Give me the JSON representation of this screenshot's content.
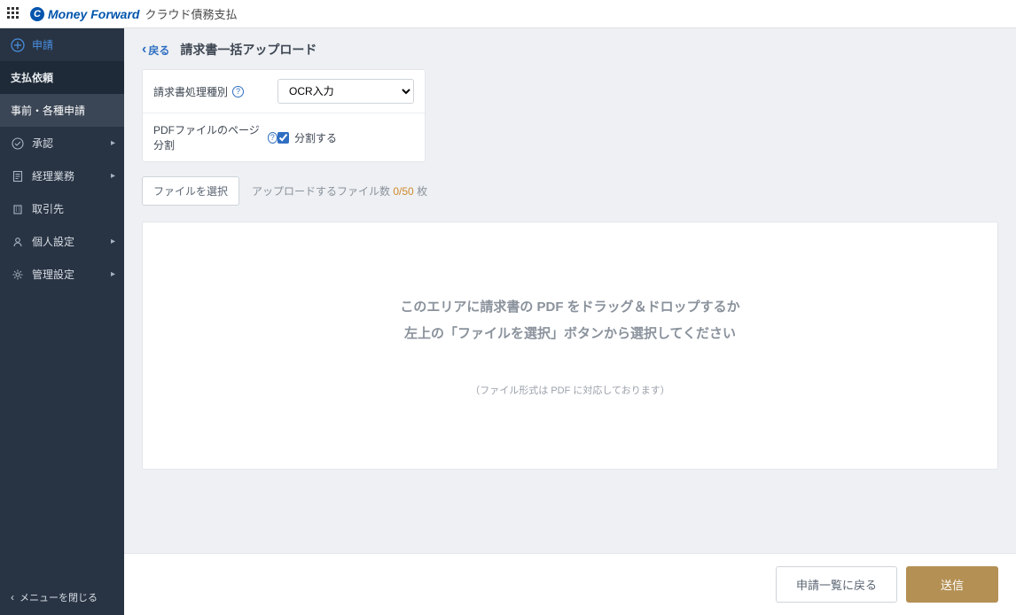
{
  "header": {
    "brand_mark": "C",
    "brand_text": "Money Forward",
    "product_name": "クラウド債務支払"
  },
  "sidebar": {
    "primary_action": "申請",
    "section_label": "支払依頼",
    "items": [
      {
        "label": "事前・各種申請",
        "expandable": false,
        "active": true
      },
      {
        "label": "承認",
        "expandable": true
      },
      {
        "label": "経理業務",
        "expandable": true
      },
      {
        "label": "取引先",
        "expandable": false
      },
      {
        "label": "個人設定",
        "expandable": true
      },
      {
        "label": "管理設定",
        "expandable": true
      }
    ],
    "collapse_label": "メニューを閉じる"
  },
  "page": {
    "back_label": "戻る",
    "title": "請求書一括アップロード"
  },
  "settings": {
    "type_label": "請求書処理種別",
    "type_value": "OCR入力",
    "split_label": "PDFファイルのページ分割",
    "split_checkbox_label": "分割する",
    "split_checked": true
  },
  "upload": {
    "select_button": "ファイルを選択",
    "count_prefix": "アップロードするファイル数 ",
    "count_current": "0",
    "count_max": "/50",
    "count_suffix": " 枚",
    "drop_line1": "このエリアに請求書の PDF をドラッグ＆ドロップするか",
    "drop_line2": "左上の「ファイルを選択」ボタンから選択してください",
    "drop_note": "（ファイル形式は PDF に対応しております）"
  },
  "footer": {
    "back_to_list": "申請一覧に戻る",
    "submit": "送信"
  }
}
